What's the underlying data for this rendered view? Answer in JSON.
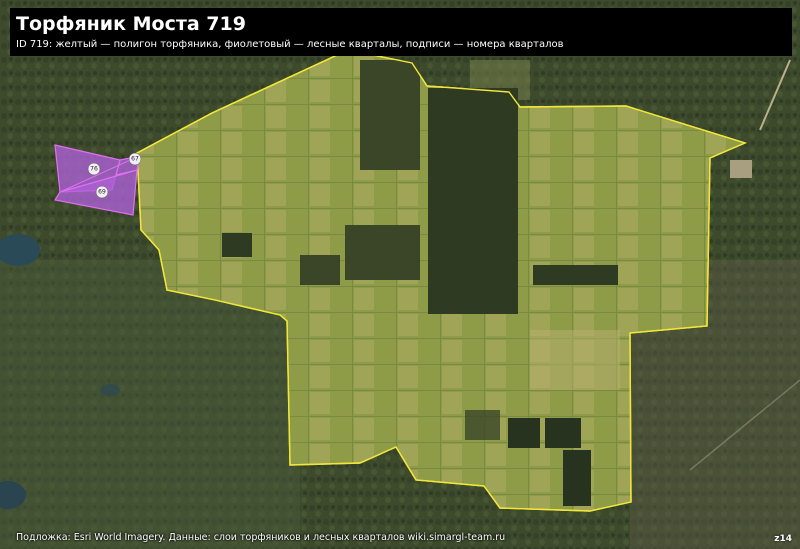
{
  "header": {
    "title": "Торфяник Моста 719",
    "subtitle": "ID 719: желтый — полигон торфяника, фиолетовый — лесные кварталы, подписи — номера кварталов"
  },
  "map": {
    "basemap": "Esri World Imagery",
    "peat_outline_color": "#f2e63a",
    "quarter_fill_color": "#b060d8",
    "quarter_outline_color": "#e070f0",
    "quarter_labels": [
      "76",
      "67",
      "69"
    ]
  },
  "attribution": "Подложка: Esri World Imagery. Данные: слои торфяников и лесных кварталов wiki.simargl-team.ru",
  "zoom": "z14"
}
